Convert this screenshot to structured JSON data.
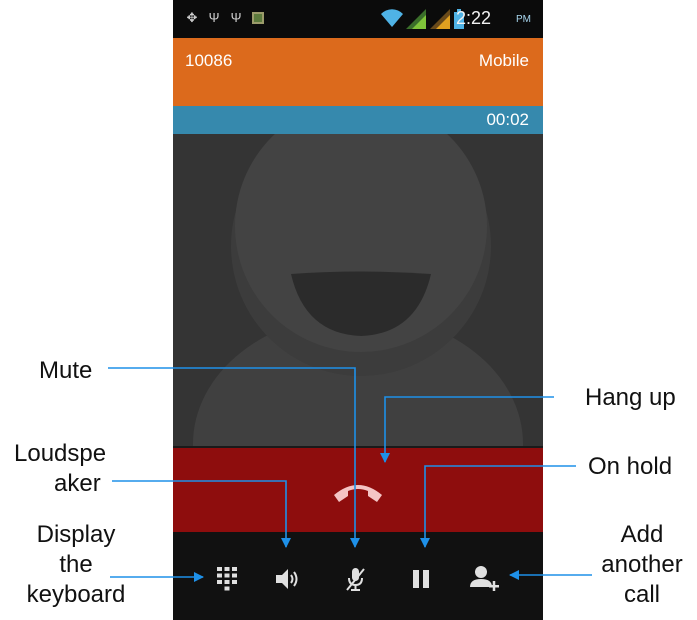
{
  "status_bar": {
    "time": "2:22",
    "ampm": "PM",
    "icons": [
      "usb-debug-icon",
      "usb-icon",
      "usb-icon",
      "image-notification-icon",
      "wifi-icon",
      "signal-icon",
      "signal-icon",
      "battery-icon"
    ]
  },
  "call": {
    "number": "10086",
    "type": "Mobile",
    "duration": "00:02"
  },
  "toolbar": {
    "icons": [
      "dialpad-icon",
      "speaker-icon",
      "mic-mute-icon",
      "pause-icon",
      "add-contact-icon"
    ]
  },
  "colors": {
    "header": "#dc6a1c",
    "timer_bar": "#3689ad",
    "hangup_area": "#8e0d0d",
    "hangup_icon": "#f4c4c4",
    "annotation_line": "#1e90e8"
  },
  "annotations": {
    "mute": "Mute",
    "hang_up": "Hang up",
    "loudspeaker": [
      "Loudspe",
      "aker"
    ],
    "on_hold": "On hold",
    "display_keyboard": [
      "Display",
      "the",
      "keyboard"
    ],
    "add_call": [
      "Add",
      "another",
      "call"
    ]
  }
}
